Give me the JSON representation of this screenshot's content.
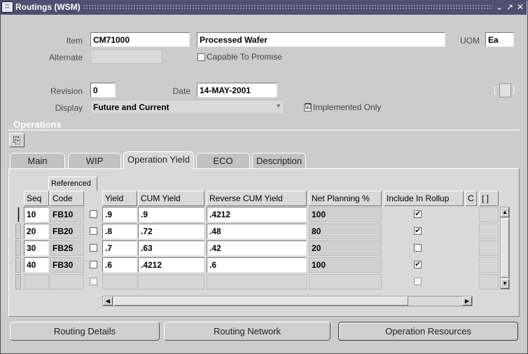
{
  "window": {
    "title": "Routings (WSM)",
    "icon_name": "oracle-form-icon"
  },
  "header": {
    "item_label": "Item",
    "item_value": "CM71000",
    "item_desc": "Processed Wafer",
    "uom_label": "UOM",
    "uom_value": "Ea",
    "alternate_label": "Alternate",
    "alternate_value": "",
    "ctp_label": "Capable To Promise",
    "revision_label": "Revision",
    "revision_value": "0",
    "date_label": "Date",
    "date_value": "14-MAY-2001",
    "display_label": "Display",
    "display_value": "Future and Current",
    "implemented_label": "Implemented Only",
    "implemented_checked": "☑",
    "bracket_label": "[ ]"
  },
  "operations": {
    "title": "Operations",
    "tabs": [
      "Main",
      "WIP",
      "Operation Yield",
      "ECO",
      "Description"
    ],
    "active_tab": "Operation Yield",
    "referenced_label": "Referenced",
    "columns": {
      "seq": "Seq",
      "code": "Code",
      "yield": "Yield",
      "cum_yield": "CUM Yield",
      "rev_cum_yield": "Reverse CUM Yield",
      "net_planning": "Net Planning %",
      "include_rollup": "Include In Rollup",
      "c": "C",
      "bracket": "[ ]"
    },
    "rows": [
      {
        "seq": "10",
        "code": "FB10",
        "yield": ".9",
        "cum_yield": ".9",
        "rev_cum_yield": ".4212",
        "net_planning": "100",
        "include": "✔"
      },
      {
        "seq": "20",
        "code": "FB20",
        "yield": ".8",
        "cum_yield": ".72",
        "rev_cum_yield": ".48",
        "net_planning": "80",
        "include": "✔"
      },
      {
        "seq": "30",
        "code": "FB25",
        "yield": ".7",
        "cum_yield": ".63",
        "rev_cum_yield": ".42",
        "net_planning": "20",
        "include": ""
      },
      {
        "seq": "40",
        "code": "FB30",
        "yield": ".6",
        "cum_yield": ".4212",
        "rev_cum_yield": ".6",
        "net_planning": "100",
        "include": "✔"
      }
    ]
  },
  "buttons": {
    "routing_details": "Routing Details",
    "routing_network": "Routing Network",
    "operation_resources": "Operation Resources"
  }
}
